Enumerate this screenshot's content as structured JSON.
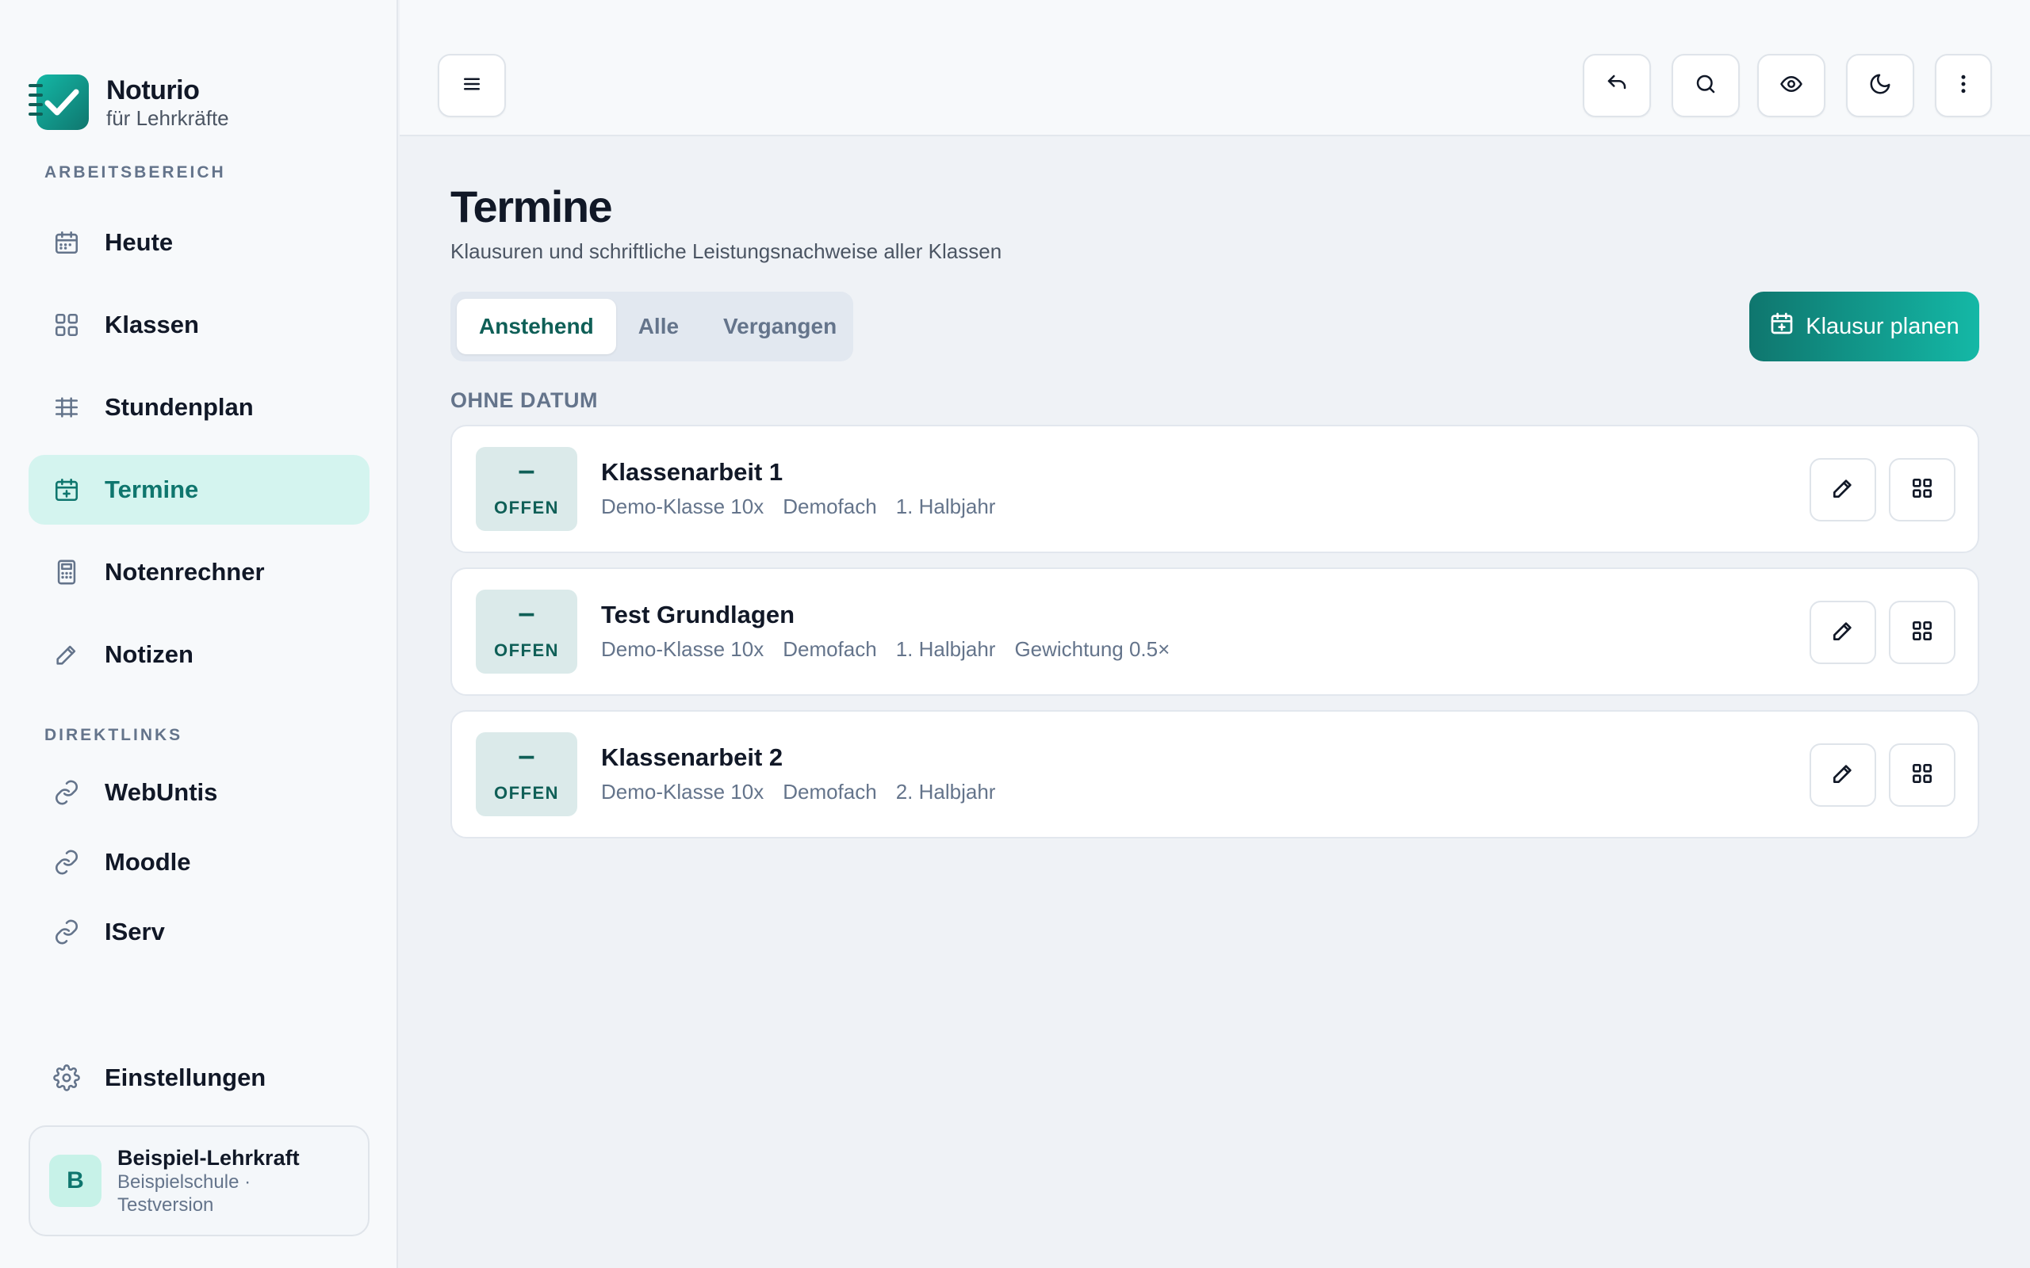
{
  "brand": {
    "name": "Noturio",
    "subtitle": "für Lehrkräfte"
  },
  "sidebar": {
    "sections": [
      {
        "label": "ARBEITSBEREICH"
      },
      {
        "label": "DIREKTLINKS"
      }
    ],
    "work_items": [
      {
        "label": "Heute",
        "icon": "calendar-icon"
      },
      {
        "label": "Klassen",
        "icon": "grid-icon"
      },
      {
        "label": "Stundenplan",
        "icon": "timetable-icon"
      },
      {
        "label": "Termine",
        "icon": "calendar-plus-icon",
        "active": true
      },
      {
        "label": "Notenrechner",
        "icon": "calculator-icon"
      },
      {
        "label": "Notizen",
        "icon": "pencil-icon"
      }
    ],
    "links": [
      {
        "label": "WebUntis",
        "icon": "link-icon"
      },
      {
        "label": "Moodle",
        "icon": "link-icon"
      },
      {
        "label": "IServ",
        "icon": "link-icon"
      }
    ],
    "settings": {
      "label": "Einstellungen",
      "icon": "gear-icon"
    },
    "user": {
      "initial": "B",
      "name": "Beispiel-Lehrkraft",
      "sub": "Beispielschule · Testversion"
    }
  },
  "topbar": {
    "icons": [
      "menu-icon",
      "undo-icon",
      "search-icon",
      "eye-icon",
      "moon-icon",
      "more-vertical-icon"
    ]
  },
  "main": {
    "title": "Termine",
    "subtitle": "Klausuren und schriftliche Leistungsnachweise aller Klassen",
    "tabs": [
      {
        "label": "Anstehend",
        "active": true
      },
      {
        "label": "Alle"
      },
      {
        "label": "Vergangen"
      }
    ],
    "primary_button": "Klausur planen",
    "group_label": "OHNE DATUM",
    "items": [
      {
        "status_symbol": "–",
        "status": "OFFEN",
        "title": "Klassenarbeit 1",
        "meta": [
          "Demo-Klasse 10x",
          "Demofach",
          "1. Halbjahr"
        ]
      },
      {
        "status_symbol": "–",
        "status": "OFFEN",
        "title": "Test Grundlagen",
        "meta": [
          "Demo-Klasse 10x",
          "Demofach",
          "1. Halbjahr",
          "Gewichtung 0.5×"
        ]
      },
      {
        "status_symbol": "–",
        "status": "OFFEN",
        "title": "Klassenarbeit 2",
        "meta": [
          "Demo-Klasse 10x",
          "Demofach",
          "2. Halbjahr"
        ]
      }
    ]
  },
  "colors": {
    "accent": "#0f766e",
    "accent_light": "#14b8a6",
    "active_bg": "#d4f4ef"
  }
}
